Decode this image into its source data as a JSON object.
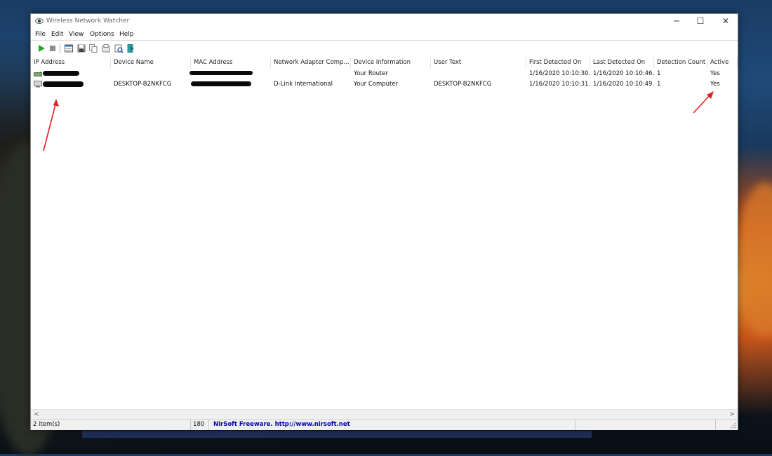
{
  "window": {
    "title": "Wireless Network Watcher",
    "minimize_glyph": "─",
    "maximize_glyph": "☐",
    "close_glyph": "✕"
  },
  "menu": [
    "File",
    "Edit",
    "View",
    "Options",
    "Help"
  ],
  "toolbar_icons": [
    "start-icon",
    "stop-icon",
    "html-report-icon",
    "save-icon",
    "copy-icon",
    "properties-icon",
    "advanced-options-icon",
    "exit-icon"
  ],
  "columns": [
    "IP Address",
    "Device Name",
    "MAC Address",
    "Network Adapter Comp...",
    "Device Information",
    "User Text",
    "First Detected On",
    "Last Detected On",
    "Detection Count",
    "Active"
  ],
  "rows": [
    {
      "ip": "",
      "device_name": "",
      "mac": "",
      "adapter_company": "",
      "device_info": "Your Router",
      "user_text": "",
      "first_detected": "1/16/2020 10:10:30...",
      "last_detected": "1/16/2020 10:10:46...",
      "detection_count": "1",
      "active": "Yes"
    },
    {
      "ip": "",
      "device_name": "DESKTOP-B2NKFCG",
      "mac": "",
      "adapter_company": "D-Link International",
      "device_info": "Your Computer",
      "user_text": "DESKTOP-B2NKFCG",
      "first_detected": "1/16/2020 10:10:31...",
      "last_detected": "1/16/2020 10:10:49...",
      "detection_count": "1",
      "active": "Yes"
    }
  ],
  "scrollbar": {
    "left_glyph": "<",
    "right_glyph": ">"
  },
  "status": {
    "items": "2 item(s)",
    "count": "180",
    "freeware_text": "NirSoft Freeware.  http://www.nirsoft.net"
  },
  "colors": {
    "play_green": "#1ea82a",
    "stop_gray": "#8c8c8c",
    "link_blue": "#0000b0",
    "annotation_red": "#e02020"
  }
}
